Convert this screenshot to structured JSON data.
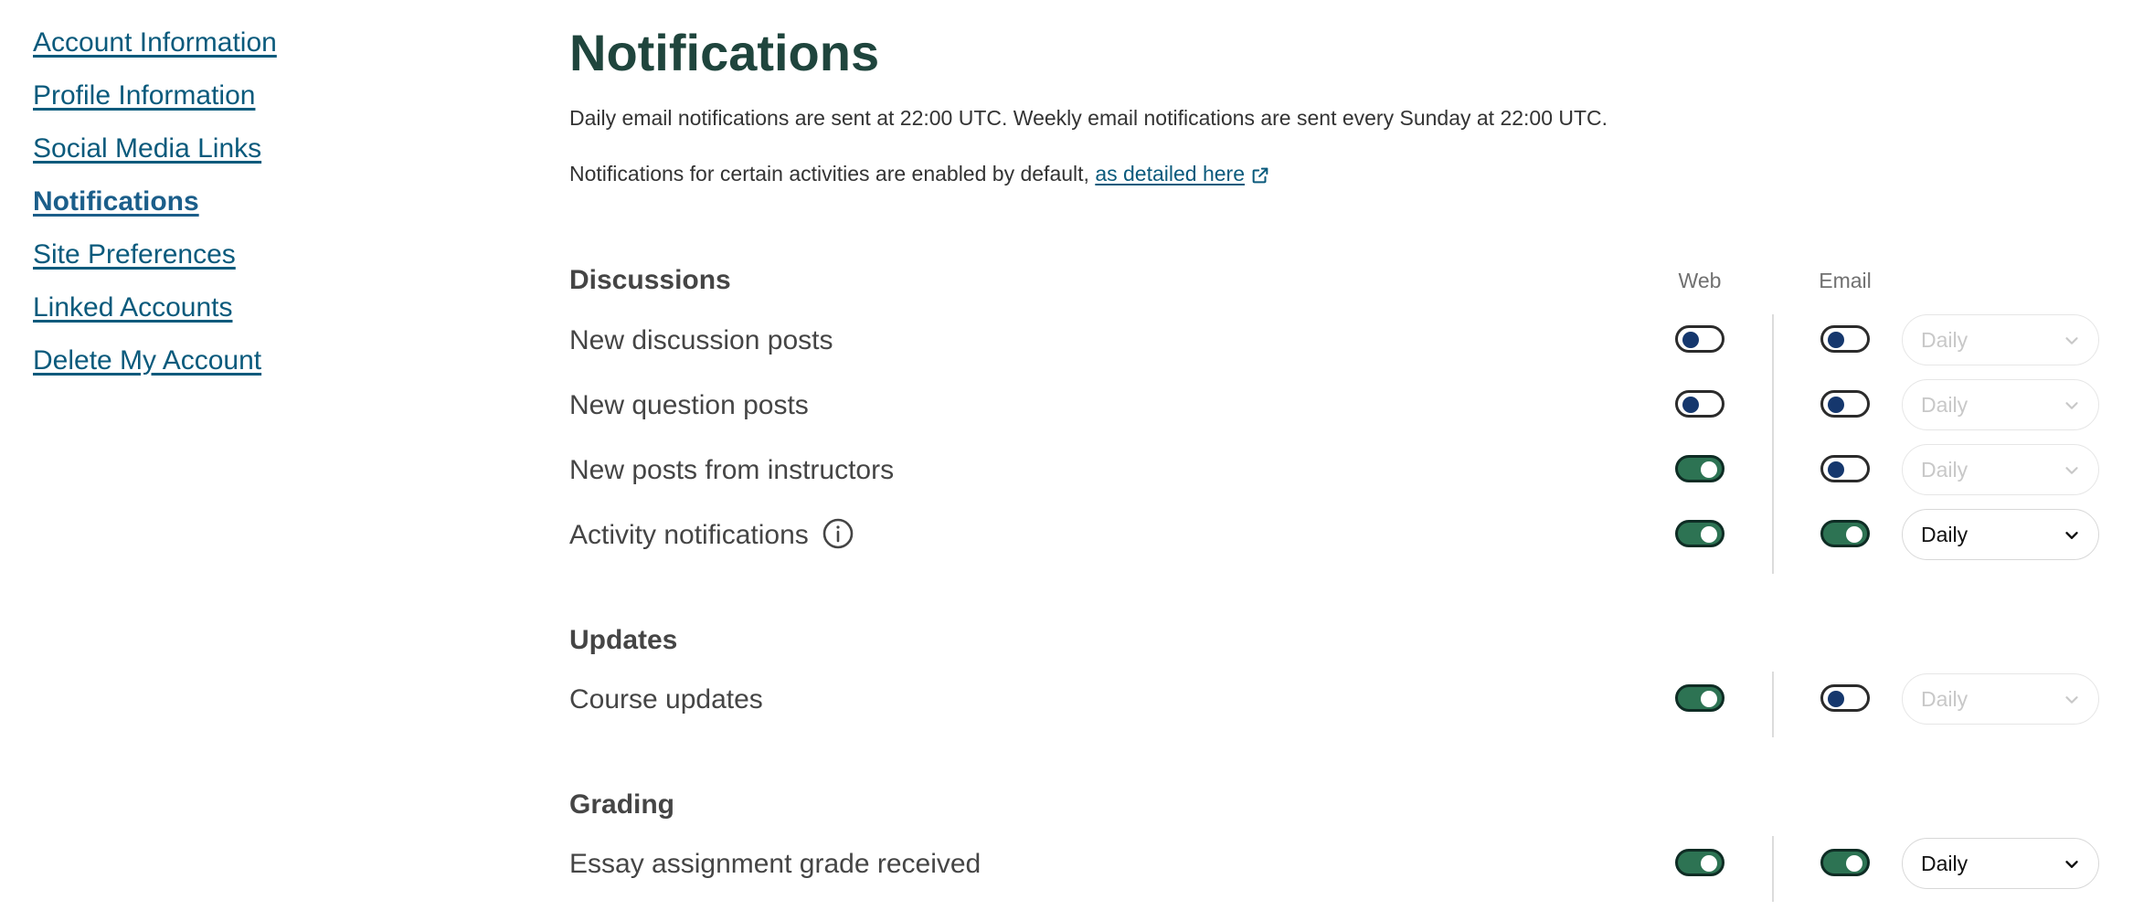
{
  "sidebar": {
    "items": [
      {
        "label": "Account Information",
        "active": false
      },
      {
        "label": "Profile Information",
        "active": false
      },
      {
        "label": "Social Media Links",
        "active": false
      },
      {
        "label": "Notifications",
        "active": true
      },
      {
        "label": "Site Preferences",
        "active": false
      },
      {
        "label": "Linked Accounts",
        "active": false
      },
      {
        "label": "Delete My Account",
        "active": false
      }
    ]
  },
  "main": {
    "title": "Notifications",
    "intro_schedule": "Daily email notifications are sent at 22:00 UTC. Weekly email notifications are sent every Sunday at 22:00 UTC.",
    "intro_default_prefix": "Notifications for certain activities are enabled by default, ",
    "intro_default_link": "as detailed here",
    "columns": {
      "web": "Web",
      "email": "Email"
    },
    "sections": [
      {
        "title": "Discussions",
        "rows": [
          {
            "label": "New discussion posts",
            "web": false,
            "email": false,
            "cadence": "Daily",
            "cadence_enabled": false
          },
          {
            "label": "New question posts",
            "web": false,
            "email": false,
            "cadence": "Daily",
            "cadence_enabled": false
          },
          {
            "label": "New posts from instructors",
            "web": true,
            "email": false,
            "cadence": "Daily",
            "cadence_enabled": false
          },
          {
            "label": "Activity notifications",
            "web": true,
            "email": true,
            "cadence": "Daily",
            "cadence_enabled": true
          }
        ]
      },
      {
        "title": "Updates",
        "rows": [
          {
            "label": "Course updates",
            "web": true,
            "email": false,
            "cadence": "Daily",
            "cadence_enabled": false
          }
        ]
      },
      {
        "title": "Grading",
        "rows": [
          {
            "label": "Essay assignment grade received",
            "web": true,
            "email": true,
            "cadence": "Daily",
            "cadence_enabled": true
          }
        ]
      }
    ]
  },
  "colors": {
    "link": "#0a5a7c",
    "title": "#1f453d",
    "toggle_on": "#2d7353",
    "toggle_off_knob": "#15376d"
  }
}
